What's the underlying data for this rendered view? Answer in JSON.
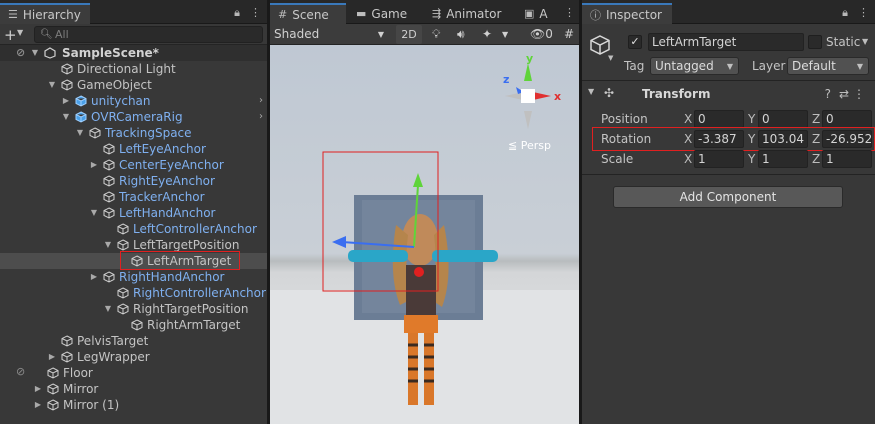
{
  "hierarchy": {
    "tab_label": "Hierarchy",
    "search_placeholder": "All",
    "scene_name": "SampleScene*",
    "items": [
      {
        "label": "Directional Light",
        "color": "default"
      },
      {
        "label": "GameObject",
        "color": "default"
      },
      {
        "label": "unitychan",
        "color": "blue"
      },
      {
        "label": "OVRCameraRig",
        "color": "blue"
      },
      {
        "label": "TrackingSpace",
        "color": "blue"
      },
      {
        "label": "LeftEyeAnchor",
        "color": "blue"
      },
      {
        "label": "CenterEyeAnchor",
        "color": "blue"
      },
      {
        "label": "RightEyeAnchor",
        "color": "blue"
      },
      {
        "label": "TrackerAnchor",
        "color": "blue"
      },
      {
        "label": "LeftHandAnchor",
        "color": "blue"
      },
      {
        "label": "LeftControllerAnchor",
        "color": "blue"
      },
      {
        "label": "LeftTargetPosition",
        "color": "default"
      },
      {
        "label": "LeftArmTarget",
        "color": "default"
      },
      {
        "label": "RightHandAnchor",
        "color": "blue"
      },
      {
        "label": "RightControllerAnchor",
        "color": "blue"
      },
      {
        "label": "RightTargetPosition",
        "color": "default"
      },
      {
        "label": "RightArmTarget",
        "color": "default"
      },
      {
        "label": "PelvisTarget",
        "color": "default"
      },
      {
        "label": "LegWrapper",
        "color": "default"
      },
      {
        "label": "Floor",
        "color": "default"
      },
      {
        "label": "Mirror",
        "color": "default"
      },
      {
        "label": "Mirror (1)",
        "color": "default"
      }
    ]
  },
  "scene": {
    "tabs": [
      "Scene",
      "Game",
      "Animator",
      "A"
    ],
    "shading_mode": "Shaded",
    "mode_2d": "2D",
    "hidden_count": "0",
    "persp_label": "Persp",
    "gizmo_axes": {
      "x": "x",
      "y": "y",
      "z": "z"
    }
  },
  "inspector": {
    "tab_label": "Inspector",
    "object_name": "LeftArmTarget",
    "static_label": "Static",
    "tag_label": "Tag",
    "tag_value": "Untagged",
    "layer_label": "Layer",
    "layer_value": "Default",
    "component_title": "Transform",
    "position": {
      "label": "Position",
      "x": "0",
      "y": "0",
      "z": "0"
    },
    "rotation": {
      "label": "Rotation",
      "x": "-3.387",
      "y": "103.04",
      "z": "-26.952"
    },
    "scale": {
      "label": "Scale",
      "x": "1",
      "y": "1",
      "z": "1"
    },
    "add_component": "Add Component"
  },
  "colors": {
    "accent": "#3a79bb",
    "highlight_red": "#e02020",
    "prefab_blue": "#7fb0f0"
  }
}
